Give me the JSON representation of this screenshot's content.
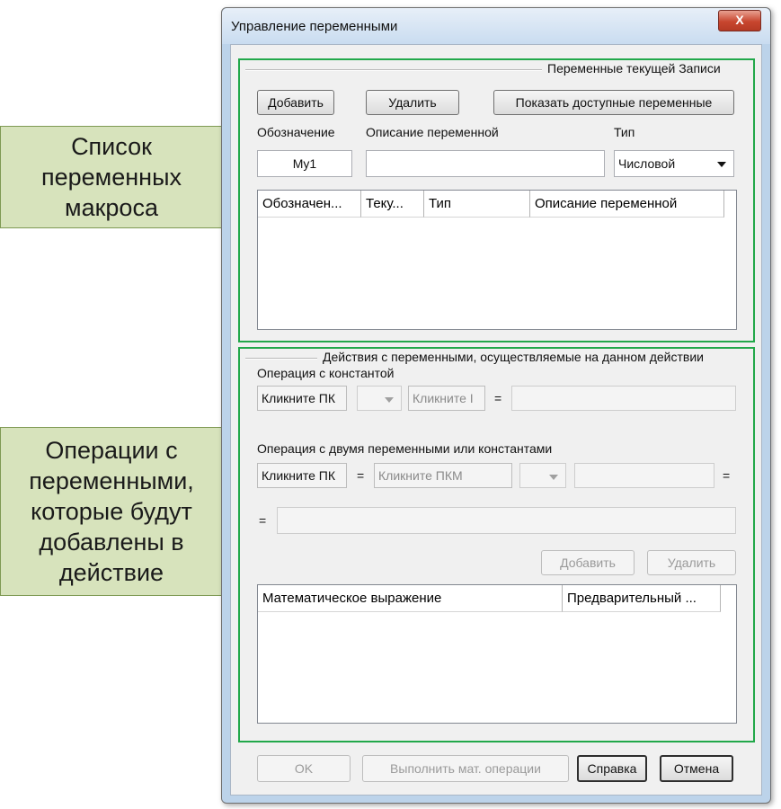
{
  "callouts": {
    "macro_vars": "Список\nпеременных\nмакроса",
    "operations": "Операции с\nпеременными,\nкоторые будут\nдобавлены в\nдействие"
  },
  "window": {
    "title": "Управление переменными",
    "close_label": "X"
  },
  "group_current": {
    "label": "Переменные текущей Записи",
    "add_label": "Добавить",
    "delete_label": "Удалить",
    "show_label": "Показать доступные переменные",
    "designation_label": "Обозначение",
    "description_label": "Описание переменной",
    "type_label": "Тип",
    "designation_value": "My1",
    "description_value": "",
    "type_value": "Числовой",
    "columns": [
      "Обозначен...",
      "Теку...",
      "Тип",
      "Описание переменной"
    ]
  },
  "group_actions": {
    "label": "Действия с переменными, осуществляемые на данном действии",
    "const_op_label": "Операция с константой",
    "const_pk1": "Кликните ПК",
    "const_pk2": "Кликните I",
    "eq": "=",
    "two_var_label": "Операция с двумя переменными или константами",
    "two_pk1": "Кликните ПК",
    "two_eq1": "=",
    "two_pk2": "Кликните ПКМ",
    "two_eq2": "=",
    "result_eq": "=",
    "add_label": "Добавить",
    "delete_label": "Удалить",
    "columns": [
      "Математическое выражение",
      "Предварительный ..."
    ]
  },
  "footer": {
    "ok_label": "OK",
    "run_label": "Выполнить мат. операции",
    "help_label": "Справка",
    "cancel_label": "Отмена"
  },
  "colors": {
    "group_border": "#22a84a",
    "callout_fill": "#d7e3bc"
  }
}
